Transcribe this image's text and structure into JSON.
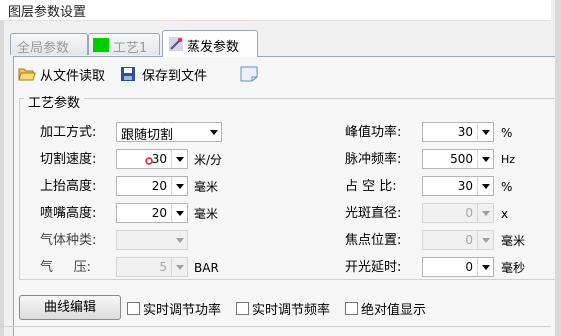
{
  "window": {
    "title": "图层参数设置"
  },
  "tabs": [
    {
      "label": "全局参数",
      "active": false
    },
    {
      "label": "工艺1",
      "active": false,
      "color": "#00cc00"
    },
    {
      "label": "蒸发参数",
      "active": true
    }
  ],
  "toolbar": {
    "read_label": "从文件读取",
    "save_label": "保存到文件"
  },
  "group": {
    "title": "工艺参数"
  },
  "left_fields": [
    {
      "label": "加工方式:",
      "value": "跟随切割",
      "type": "combo"
    },
    {
      "label": "切割速度:",
      "value": "30",
      "unit": "米/分",
      "type": "spin"
    },
    {
      "label": "上抬高度:",
      "value": "20",
      "unit": "毫米",
      "type": "spin"
    },
    {
      "label": "喷嘴高度:",
      "value": "20",
      "unit": "毫米",
      "type": "spin"
    },
    {
      "label": "气体种类:",
      "value": "",
      "type": "combo-disabled"
    },
    {
      "label": "气     压:",
      "value": "5",
      "unit": "BAR",
      "type": "spin-disabled"
    }
  ],
  "right_fields": [
    {
      "label": "峰值功率:",
      "value": "30",
      "unit": "%",
      "disabled": false
    },
    {
      "label": "脉冲频率:",
      "value": "500",
      "unit": "Hz",
      "disabled": false
    },
    {
      "label": "占 空 比:",
      "value": "30",
      "unit": "%",
      "disabled": false
    },
    {
      "label": "光斑直径:",
      "value": "0",
      "unit": "x",
      "disabled": true
    },
    {
      "label": "焦点位置:",
      "value": "0",
      "unit": "毫米",
      "disabled": true
    },
    {
      "label": "开光延时:",
      "value": "0",
      "unit": "毫秒",
      "disabled": false
    }
  ],
  "bottom": {
    "curve_button": "曲线编辑",
    "checkboxes": [
      "实时调节功率",
      "实时调节频率",
      "绝对值显示"
    ]
  },
  "colors": {
    "tab_green": "#00cc00",
    "accent_blue": "#2b4f9c"
  }
}
